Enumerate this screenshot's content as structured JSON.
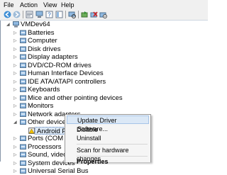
{
  "menu": [
    "File",
    "Action",
    "View",
    "Help"
  ],
  "toolbar": {
    "icons": [
      "back-icon",
      "forward-icon",
      "properties-icon",
      "computer-icon",
      "help-icon",
      "scan-hardware-icon",
      "update-driver-icon",
      "uninstall-icon",
      "disable-icon"
    ]
  },
  "tree": {
    "root": "VMDev64",
    "items": [
      {
        "label": "Batteries",
        "icon": "battery-icon"
      },
      {
        "label": "Computer",
        "icon": "computer-icon"
      },
      {
        "label": "Disk drives",
        "icon": "disk-drive-icon"
      },
      {
        "label": "Display adapters",
        "icon": "display-adapter-icon"
      },
      {
        "label": "DVD/CD-ROM drives",
        "icon": "dvd-icon"
      },
      {
        "label": "Human Interface Devices",
        "icon": "hid-icon"
      },
      {
        "label": "IDE ATA/ATAPI controllers",
        "icon": "ide-controller-icon"
      },
      {
        "label": "Keyboards",
        "icon": "keyboard-icon"
      },
      {
        "label": "Mice and other pointing devices",
        "icon": "mouse-icon"
      },
      {
        "label": "Monitors",
        "icon": "monitor-icon"
      },
      {
        "label": "Network adapters",
        "icon": "network-adapter-icon"
      },
      {
        "label": "Other devices",
        "icon": "other-devices-icon"
      },
      {
        "label": "Android Phone",
        "icon": "unknown-device-warning-icon"
      },
      {
        "label": "Ports (COM & LPT",
        "icon": "port-icon"
      },
      {
        "label": "Processors",
        "icon": "processor-icon"
      },
      {
        "label": "Sound, video and",
        "icon": "sound-icon"
      },
      {
        "label": "System devices",
        "icon": "system-device-icon"
      },
      {
        "label": "Universal Serial Bus",
        "icon": "usb-icon"
      }
    ]
  },
  "context_menu": {
    "update_driver": "Update Driver Software...",
    "disable": "Disable",
    "uninstall": "Uninstall",
    "scan": "Scan for hardware changes",
    "properties": "Properties"
  },
  "colors": {
    "highlight": "#dbe8f6",
    "menu_bg": "#f0f0f0"
  }
}
